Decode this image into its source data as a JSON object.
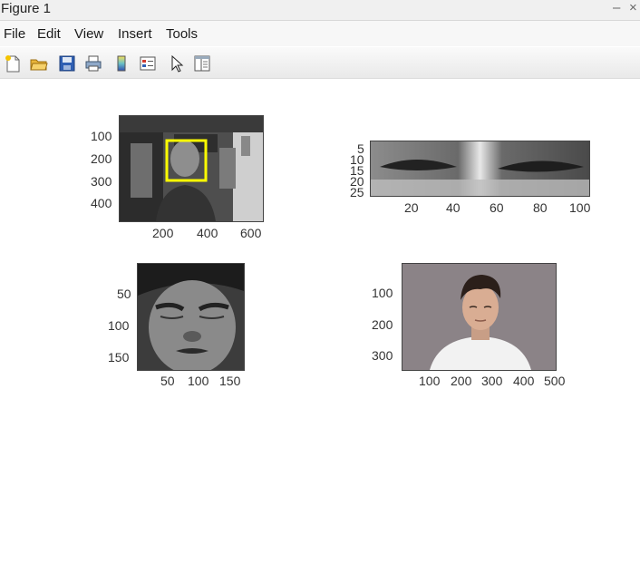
{
  "window": {
    "title": "Figure 1",
    "minimize": "–",
    "close": "×"
  },
  "menu": [
    "File",
    "Edit",
    "View",
    "Insert",
    "Tools"
  ],
  "toolbar": [
    "new-figure-icon",
    "open-folder-icon",
    "save-icon",
    "print-icon",
    "colorbar-icon",
    "legend-icon",
    "pointer-icon",
    "property-editor-icon"
  ],
  "subplots": {
    "s1": {
      "yticks": [
        "100",
        "200",
        "300",
        "400"
      ],
      "xticks": [
        "200",
        "400",
        "600"
      ],
      "box_color": "#ffff00"
    },
    "s2": {
      "yticks": [
        "5",
        "10",
        "15",
        "20",
        "25"
      ],
      "xticks": [
        "20",
        "40",
        "60",
        "80",
        "100"
      ]
    },
    "s3": {
      "yticks": [
        "50",
        "100",
        "150"
      ],
      "xticks": [
        "50",
        "100",
        "150"
      ]
    },
    "s4": {
      "yticks": [
        "100",
        "200",
        "300"
      ],
      "xticks": [
        "100",
        "200",
        "300",
        "400",
        "500"
      ]
    }
  }
}
